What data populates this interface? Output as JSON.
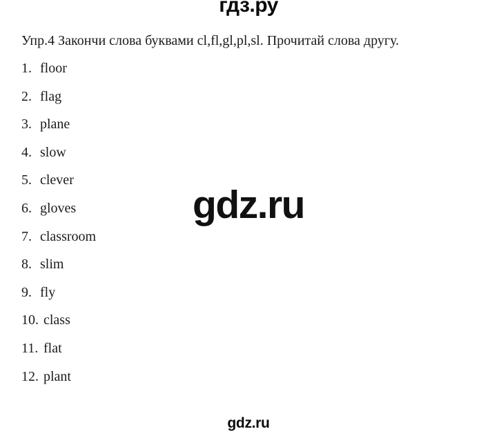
{
  "watermarks": {
    "top": "гдз.ру",
    "center": "gdz.ru",
    "bottom": "gdz.ru"
  },
  "exercise": {
    "instruction": "Упр.4 Закончи слова буквами cl,fl,gl,pl,sl. Прочитай слова другу.",
    "items": [
      {
        "number": "1.",
        "word": "floor"
      },
      {
        "number": "2.",
        "word": "flag"
      },
      {
        "number": "3.",
        "word": "plane"
      },
      {
        "number": "4.",
        "word": "slow"
      },
      {
        "number": "5.",
        "word": "clever"
      },
      {
        "number": "6.",
        "word": "gloves"
      },
      {
        "number": "7.",
        "word": "classroom"
      },
      {
        "number": "8.",
        "word": "slim"
      },
      {
        "number": "9.",
        "word": "fly"
      },
      {
        "number": "10.",
        "word": "class"
      },
      {
        "number": "11.",
        "word": "flat"
      },
      {
        "number": "12.",
        "word": "plant"
      }
    ]
  },
  "colors": {
    "background": "#ffffff",
    "text": "#1b1b1b",
    "watermark": "#111111"
  }
}
